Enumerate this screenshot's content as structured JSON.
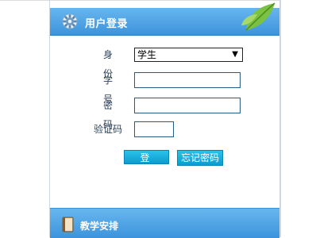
{
  "login_panel": {
    "title": "用户登录",
    "icon": "gear-icon",
    "decoration": "leaf-icon",
    "identity_label": "身 份",
    "identity_value": "学生",
    "student_id_label": "学 号",
    "student_id_value": "",
    "password_label": "密 码",
    "password_value": "",
    "captcha_label": "验证码",
    "captcha_value": "",
    "login_button": "登 录",
    "forgot_button": "忘记密码"
  },
  "schedule_panel": {
    "title": "教学安排",
    "icon": "book-icon"
  },
  "colors": {
    "header_blue": "#4aa3e3",
    "button_cyan": "#14abdb",
    "label_text": "#2d4258"
  }
}
